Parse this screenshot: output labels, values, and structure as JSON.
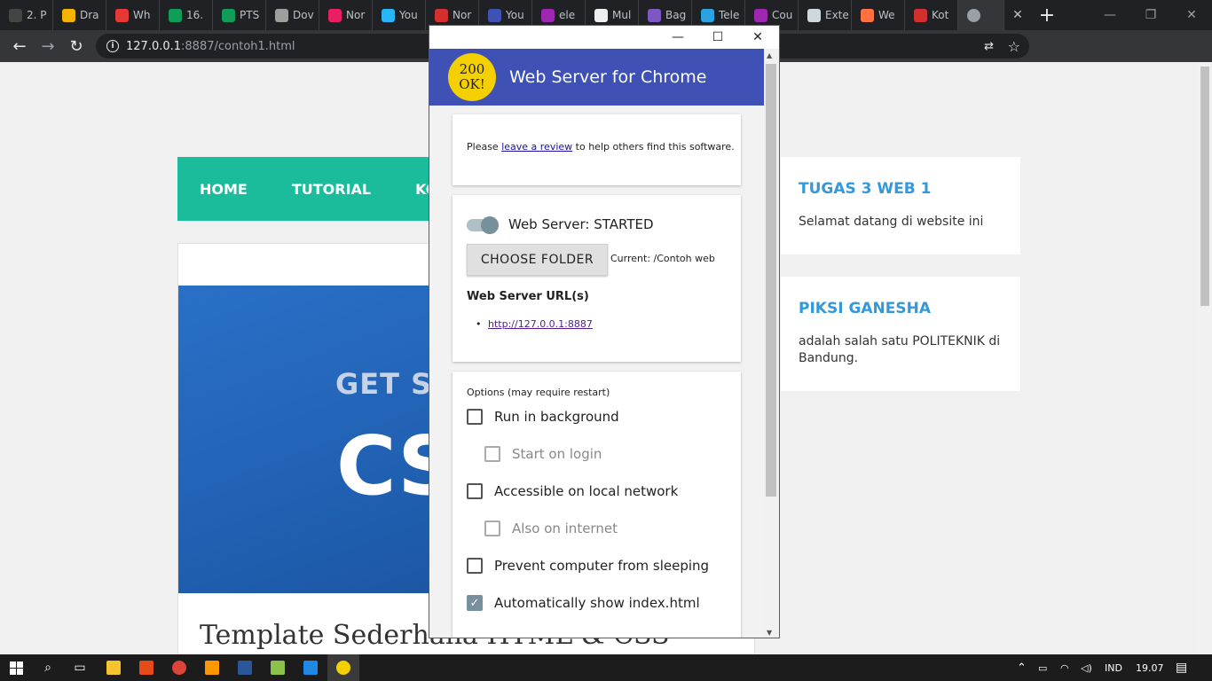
{
  "browser": {
    "tabs": [
      {
        "label": "2. P",
        "color": "#444444"
      },
      {
        "label": "Dra",
        "color": "#f4b400"
      },
      {
        "label": "Wh",
        "color": "#e53935"
      },
      {
        "label": "16.",
        "color": "#0f9d58"
      },
      {
        "label": "PTS",
        "color": "#0f9d58"
      },
      {
        "label": "Dov",
        "color": "#9e9e9e"
      },
      {
        "label": "Nor",
        "color": "#e91e63"
      },
      {
        "label": "You",
        "color": "#29b6f6"
      },
      {
        "label": "Nor",
        "color": "#d32f2f"
      },
      {
        "label": "You",
        "color": "#3f51b5"
      },
      {
        "label": "ele",
        "color": "#9c27b0"
      },
      {
        "label": "Mul",
        "color": "#eeeeee"
      },
      {
        "label": "Bag",
        "color": "#7e57c2"
      },
      {
        "label": "Tele",
        "color": "#2aa3e0"
      },
      {
        "label": "Cou",
        "color": "#9c27b0"
      },
      {
        "label": "Exte",
        "color": "#cfd8dc"
      },
      {
        "label": "We",
        "color": "#ff7043"
      },
      {
        "label": "Kot",
        "color": "#d32f2f"
      }
    ],
    "active_tab_color": "#9aa0a6",
    "new_tab_symbol": "+",
    "address": {
      "host": "127.0.0.1",
      "path": ":8887/contoh1.html"
    },
    "window_controls": {
      "minimize": "—",
      "restore": "❐",
      "close": "✕"
    }
  },
  "site": {
    "nav": [
      "HOME",
      "TUTORIAL",
      "KON"
    ],
    "hero": {
      "line1": "GET ST",
      "line2": "CS"
    },
    "article_title": "Template Sederhana HTML & CSS",
    "widgets": [
      {
        "title": "TUGAS 3 WEB 1",
        "text": "Selamat datang di website ini"
      },
      {
        "title": "PIKSI GANESHA",
        "text": "adalah salah satu POLITEKNIK di Bandung."
      }
    ]
  },
  "app": {
    "title": "Web Server for Chrome",
    "logo": {
      "line1": "200",
      "line2": "OK!"
    },
    "controls": {
      "minimize": "—",
      "maximize": "☐",
      "close": "✕"
    },
    "review": {
      "before": "Please ",
      "link": "leave a review",
      "after": " to help others find this software."
    },
    "server_status": "Web Server: STARTED",
    "choose_folder": "CHOOSE FOLDER",
    "current_folder": "Current: /Contoh web",
    "url_heading": "Web Server URL(s)",
    "url": "http://127.0.0.1:8887",
    "options_heading": "Options (may require restart)",
    "options": [
      {
        "label": "Run in background",
        "checked": false,
        "sub": false
      },
      {
        "label": "Start on login",
        "checked": false,
        "sub": true
      },
      {
        "label": "Accessible on local network",
        "checked": false,
        "sub": false
      },
      {
        "label": "Also on internet",
        "checked": false,
        "sub": true
      },
      {
        "label": "Prevent computer from sleeping",
        "checked": false,
        "sub": false
      },
      {
        "label": "Automatically show index.html",
        "checked": true,
        "sub": false
      }
    ]
  },
  "taskbar": {
    "language": "IND",
    "time": "19.07"
  }
}
